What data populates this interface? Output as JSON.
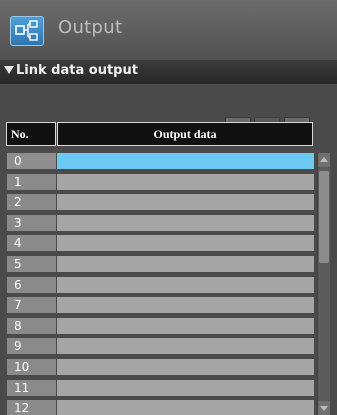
{
  "window": {
    "title": "Output",
    "icon": "link-output-icon"
  },
  "section": {
    "label": "Link data output",
    "expanded": true
  },
  "toolbar": {
    "copy_icon": "copy-icon",
    "paste_icon": "paste-icon",
    "delete_icon": "trash-icon"
  },
  "table": {
    "columns": [
      "No.",
      "Output data"
    ],
    "selected_index": 0,
    "rows": [
      {
        "no": "0",
        "output": ""
      },
      {
        "no": "1",
        "output": ""
      },
      {
        "no": "2",
        "output": ""
      },
      {
        "no": "3",
        "output": ""
      },
      {
        "no": "4",
        "output": ""
      },
      {
        "no": "5",
        "output": ""
      },
      {
        "no": "6",
        "output": ""
      },
      {
        "no": "7",
        "output": ""
      },
      {
        "no": "8",
        "output": ""
      },
      {
        "no": "9",
        "output": ""
      },
      {
        "no": "10",
        "output": ""
      },
      {
        "no": "11",
        "output": ""
      },
      {
        "no": "12",
        "output": ""
      }
    ]
  },
  "colors": {
    "selected_row": "#6dc8f2",
    "title_icon": "#3a8ccb"
  }
}
